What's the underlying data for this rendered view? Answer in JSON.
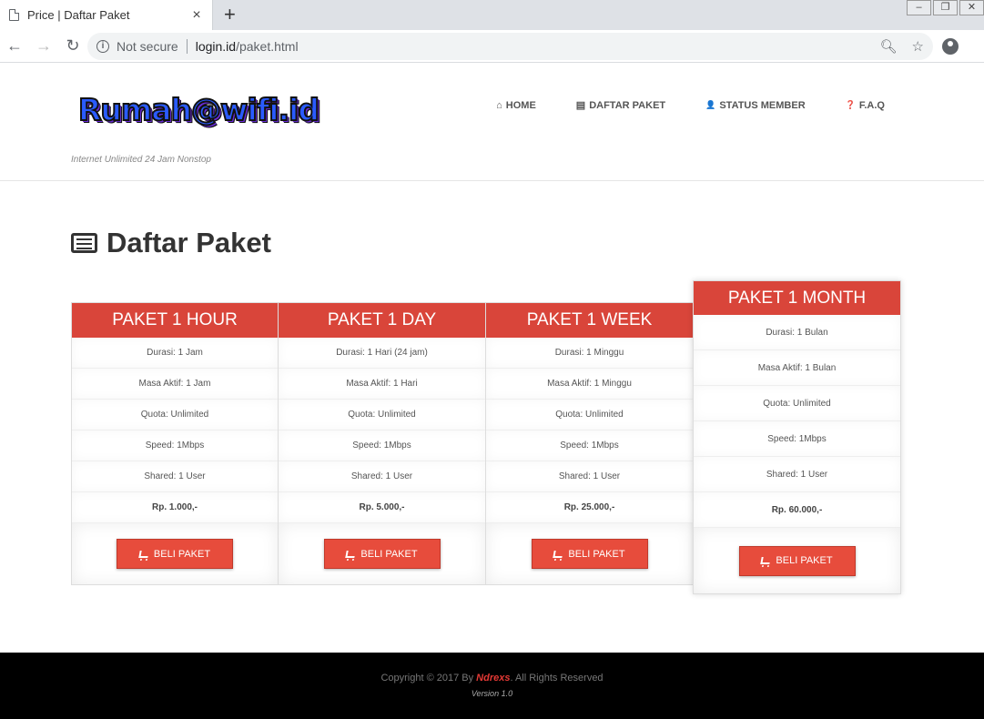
{
  "browser": {
    "tab_title": "Price | Daftar Paket",
    "tab_close": "×",
    "new_tab": "+",
    "window_buttons": [
      "–",
      "❐",
      "✕"
    ],
    "security_label": "Not secure",
    "url_host": "login.id",
    "url_path": "/paket.html"
  },
  "header": {
    "logo_text": "Rumah@wifi.id",
    "tagline": "Internet Unlimited 24 Jam Nonstop",
    "nav": [
      {
        "icon": "home-icon",
        "glyph": "⌂",
        "label": "HOME"
      },
      {
        "icon": "card-icon",
        "glyph": "▤",
        "label": "DAFTAR PAKET"
      },
      {
        "icon": "user-icon",
        "glyph": "👤",
        "label": "STATUS MEMBER"
      },
      {
        "icon": "question-icon",
        "glyph": "❓",
        "label": "F.A.Q"
      }
    ]
  },
  "main": {
    "title": "Daftar Paket",
    "plans": [
      {
        "name": "PAKET 1 HOUR",
        "durasi": "Durasi: 1 Jam",
        "masa_aktif": "Masa Aktif: 1 Jam",
        "quota": "Quota: Unlimited",
        "speed": "Speed: 1Mbps",
        "shared": "Shared: 1 User",
        "price": "Rp. 1.000,-",
        "button": "BELI PAKET"
      },
      {
        "name": "PAKET 1 DAY",
        "durasi": "Durasi: 1 Hari (24 jam)",
        "masa_aktif": "Masa Aktif: 1 Hari",
        "quota": "Quota: Unlimited",
        "speed": "Speed: 1Mbps",
        "shared": "Shared: 1 User",
        "price": "Rp. 5.000,-",
        "button": "BELI PAKET"
      },
      {
        "name": "PAKET 1 WEEK",
        "durasi": "Durasi: 1 Minggu",
        "masa_aktif": "Masa Aktif: 1 Minggu",
        "quota": "Quota: Unlimited",
        "speed": "Speed: 1Mbps",
        "shared": "Shared: 1 User",
        "price": "Rp. 25.000,-",
        "button": "BELI PAKET"
      },
      {
        "name": "PAKET 1 MONTH",
        "durasi": "Durasi: 1 Bulan",
        "masa_aktif": "Masa Aktif: 1 Bulan",
        "quota": "Quota: Unlimited",
        "speed": "Speed: 1Mbps",
        "shared": "Shared: 1 User",
        "price": "Rp. 60.000,-",
        "button": "BELI PAKET"
      }
    ]
  },
  "footer": {
    "copyright_prefix": "Copyright © 2017 By ",
    "author": "Ndrexs",
    "copyright_suffix": ". All Rights Reserved",
    "version": "Version 1.0"
  },
  "colors": {
    "accent": "#d9453a",
    "button": "#e74c3c",
    "footer_bg": "#000000"
  }
}
